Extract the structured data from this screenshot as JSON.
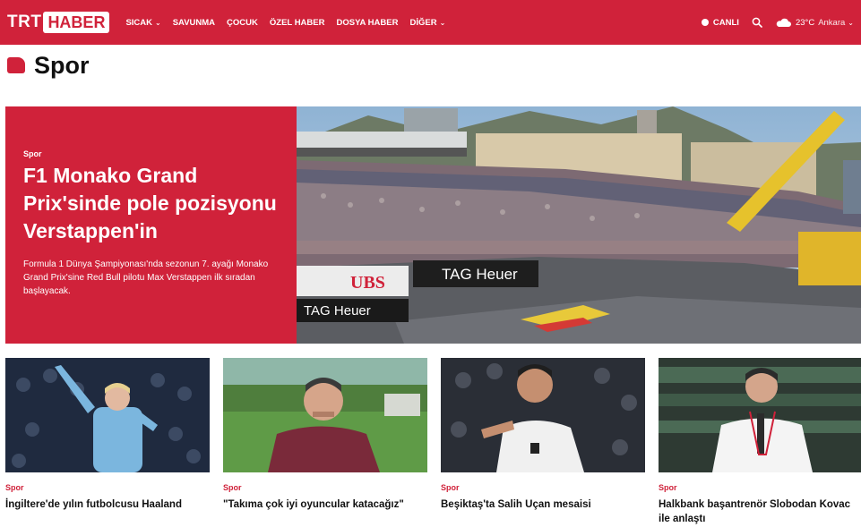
{
  "brand": {
    "logo_left": "TRT",
    "logo_right": "HABER",
    "accent": "#d0223a"
  },
  "nav": {
    "items": [
      {
        "label": "SICAK",
        "has_dropdown": true
      },
      {
        "label": "SAVUNMA",
        "has_dropdown": false
      },
      {
        "label": "ÇOCUK",
        "has_dropdown": false
      },
      {
        "label": "ÖZEL HABER",
        "has_dropdown": false
      },
      {
        "label": "DOSYA HABER",
        "has_dropdown": false
      },
      {
        "label": "DİĞER",
        "has_dropdown": true
      }
    ],
    "live_label": "CANLI",
    "weather": {
      "temp": "23°C",
      "city": "Ankara",
      "icon": "cloud-icon"
    }
  },
  "section": {
    "title": "Spor"
  },
  "hero": {
    "category": "Spor",
    "title": "F1 Monako Grand Prix'sinde pole pozisyonu Verstappen'in",
    "description": "Formula 1 Dünya Şampiyonası'nda sezonun 7. ayağı Monako Grand Prix'sine Red Bull pilotu Max Verstappen ilk sıradan başlayacak.",
    "image_signs": [
      "UBS",
      "TAG Heuer",
      "TAG Heuer"
    ]
  },
  "cards": [
    {
      "category": "Spor",
      "title": "İngiltere'de yılın futbolcusu Haaland"
    },
    {
      "category": "Spor",
      "title": "\"Takıma çok iyi oyuncular katacağız\""
    },
    {
      "category": "Spor",
      "title": "Beşiktaş'ta Salih Uçan mesaisi"
    },
    {
      "category": "Spor",
      "title": "Halkbank başantrenör Slobodan Kovac ile anlaştı"
    }
  ]
}
